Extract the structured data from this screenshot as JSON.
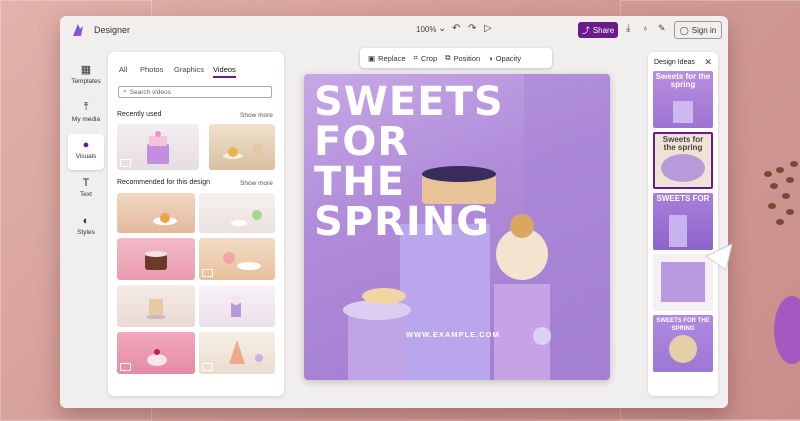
{
  "app": {
    "title": "Designer",
    "zoom": "100%",
    "share_label": "Share",
    "signin_label": "Sign in"
  },
  "rail": [
    {
      "label": "Templates",
      "icon": "templates-icon"
    },
    {
      "label": "My media",
      "icon": "upload-icon"
    },
    {
      "label": "Visuals",
      "icon": "visuals-icon"
    },
    {
      "label": "Text",
      "icon": "text-icon"
    },
    {
      "label": "Styles",
      "icon": "styles-icon"
    }
  ],
  "panel": {
    "tabs": [
      "All",
      "Photos",
      "Graphics",
      "Videos"
    ],
    "active_tab": "Videos",
    "search_placeholder": "Search videos",
    "recent_title": "Recently used",
    "recommended_title": "Recommended for this design",
    "show_more": "Show more"
  },
  "toolbar": {
    "replace": "Replace",
    "crop": "Crop",
    "position": "Position",
    "opacity": "Opacity"
  },
  "canvas": {
    "headline_lines": [
      "SWEETS",
      "FOR",
      "THE",
      "SPRING"
    ],
    "url": "WWW.EXAMPLE.COM"
  },
  "ideas": {
    "title": "Design Ideas",
    "items": [
      {
        "text": "Sweets for the spring"
      },
      {
        "text": "Sweets for the spring"
      },
      {
        "text": "SWEETS FOR"
      },
      {
        "text": ""
      },
      {
        "text": "SWEETS FOR THE SPRING"
      }
    ]
  },
  "colors": {
    "accent": "#6b1a8a",
    "canvas_bg": "#b08bd9",
    "background": "#d9a5a0"
  }
}
